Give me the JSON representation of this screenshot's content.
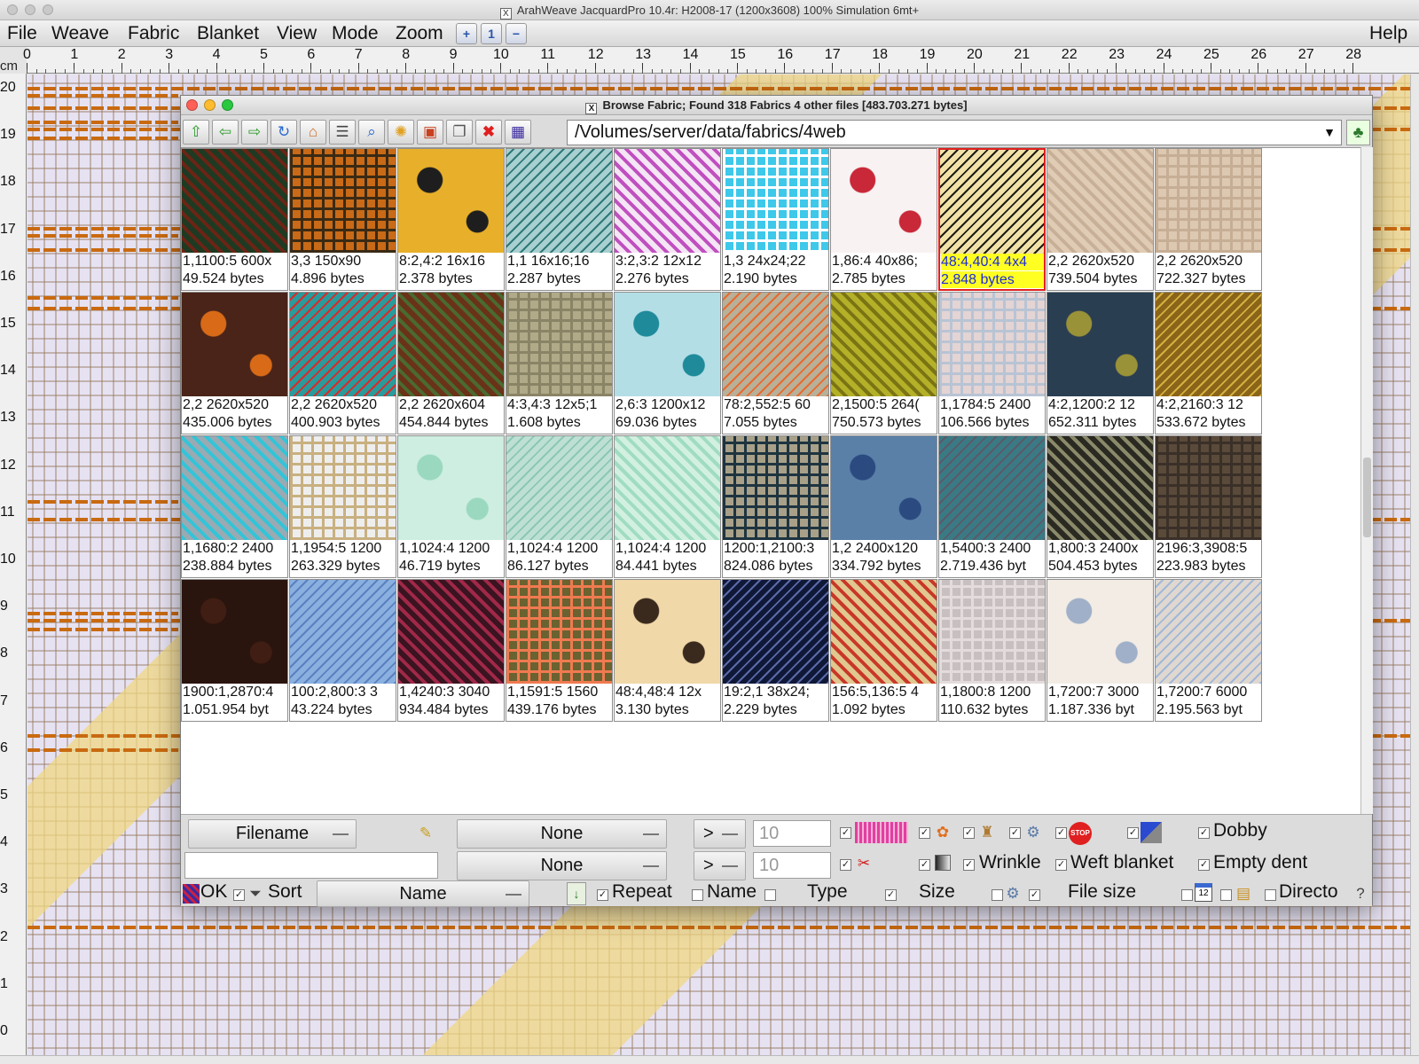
{
  "app": {
    "title": "ArahWeave JacquardPro 10.4r: H2008-17 (1200x3608) 100% Simulation 6mt+"
  },
  "menubar": {
    "items": [
      "File",
      "Weave",
      "Fabric",
      "Blanket",
      "View",
      "Mode",
      "Zoom"
    ],
    "help": "Help"
  },
  "ruler": {
    "unit": "cm",
    "top_ticks": [
      "0",
      "1",
      "2",
      "3",
      "4",
      "5",
      "6",
      "7",
      "8",
      "9",
      "10",
      "11",
      "12",
      "13",
      "14",
      "15",
      "16",
      "17",
      "18",
      "19",
      "20",
      "21",
      "22",
      "23",
      "24",
      "25",
      "26",
      "27",
      "28"
    ],
    "left_ticks": [
      "20",
      "19",
      "18",
      "17",
      "16",
      "15",
      "14",
      "13",
      "12",
      "11",
      "10",
      "9",
      "8",
      "7",
      "6",
      "5",
      "4",
      "3",
      "2",
      "1",
      "0"
    ]
  },
  "dialog": {
    "title": "Browse Fabric; Found 318 Fabrics 4 other files [483.703.271 bytes]",
    "path": "/Volumes/server/data/fabrics/4web",
    "toolbar_icons": [
      "arrow-up-icon",
      "arrow-left-icon",
      "arrow-right-icon",
      "refresh-icon",
      "home-icon",
      "list-view-icon",
      "preview-icon",
      "new-icon",
      "image-icon",
      "copy-icon",
      "delete-icon",
      "fabric-icon"
    ],
    "fabrics": [
      {
        "line1": "1,1100:5 600x",
        "line2": "49.524 bytes",
        "swatch": "#1e3a22",
        "accent": "#6b2415",
        "selected": false
      },
      {
        "line1": "3,3 150x90",
        "line2": "4.896 bytes",
        "swatch": "#c86a18",
        "accent": "#3a2a14",
        "selected": false
      },
      {
        "line1": "8:2,4:2 16x16",
        "line2": "2.378 bytes",
        "swatch": "#e8b02a",
        "accent": "#1e1e1e",
        "selected": false
      },
      {
        "line1": "1,1 16x16;16",
        "line2": "2.287 bytes",
        "swatch": "#a8d0d0",
        "accent": "#2f7878",
        "selected": false
      },
      {
        "line1": "3:2,3:2 12x12",
        "line2": "2.276 bytes",
        "swatch": "#f4e6f4",
        "accent": "#c050c0",
        "selected": false
      },
      {
        "line1": "1,3 24x24;22",
        "line2": "2.190 bytes",
        "swatch": "#3ec8ea",
        "accent": "#ffffff",
        "selected": false
      },
      {
        "line1": "1,86:4 40x86;",
        "line2": "2.785 bytes",
        "swatch": "#f8f2f2",
        "accent": "#c82838",
        "selected": false
      },
      {
        "line1": "48:4,40:4 4x4",
        "line2": "2.848 bytes",
        "swatch": "#f2e2a8",
        "accent": "#1c1c14",
        "selected": true
      },
      {
        "line1": "2,2 2620x520",
        "line2": "739.504 bytes",
        "swatch": "#e0cbb5",
        "accent": "#c8b098",
        "selected": false
      },
      {
        "line1": "2,2 2620x520",
        "line2": "722.327 bytes",
        "swatch": "#ddc8b2",
        "accent": "#c6ae95",
        "selected": false
      },
      {
        "line1": "2,2 2620x520",
        "line2": "435.006 bytes",
        "swatch": "#4a2418",
        "accent": "#d86a18",
        "selected": false
      },
      {
        "line1": "2,2 2620x520",
        "line2": "400.903 bytes",
        "swatch": "#2a9a9a",
        "accent": "#e02828",
        "selected": false
      },
      {
        "line1": "2,2 2620x604",
        "line2": "454.844 bytes",
        "swatch": "#6a3218",
        "accent": "#4a6a30",
        "selected": false
      },
      {
        "line1": "4:3,4:3 12x5;1",
        "line2": "1.608 bytes",
        "swatch": "#b0aa88",
        "accent": "#8a8466",
        "selected": false
      },
      {
        "line1": "2,6:3 1200x12",
        "line2": "69.036 bytes",
        "swatch": "#b4dee6",
        "accent": "#1e8a9a",
        "selected": false
      },
      {
        "line1": "78:2,552:5 60",
        "line2": "7.055 bytes",
        "swatch": "#b8b098",
        "accent": "#e86a30",
        "selected": false
      },
      {
        "line1": "2,1500:5 264(",
        "line2": "750.573 bytes",
        "swatch": "#b4b028",
        "accent": "#7a7414",
        "selected": false
      },
      {
        "line1": "1,1784:5 2400",
        "line2": "106.566 bytes",
        "swatch": "#e4d4d4",
        "accent": "#b8c4d4",
        "selected": false
      },
      {
        "line1": "4:2,1200:2 12",
        "line2": "652.311 bytes",
        "swatch": "#2a3e52",
        "accent": "#9a9238",
        "selected": false
      },
      {
        "line1": "4:2,2160:3 12",
        "line2": "533.672 bytes",
        "swatch": "#8a6418",
        "accent": "#d4b040",
        "selected": false
      },
      {
        "line1": "1,1680:2 2400",
        "line2": "238.884 bytes",
        "swatch": "#9aaab2",
        "accent": "#34c4d8",
        "selected": false
      },
      {
        "line1": "1,1954:5 1200",
        "line2": "263.329 bytes",
        "swatch": "#eeeeee",
        "accent": "#c8b080",
        "selected": false
      },
      {
        "line1": "1,1024:4 1200",
        "line2": "46.719 bytes",
        "swatch": "#cdeee0",
        "accent": "#9ad8c0",
        "selected": false
      },
      {
        "line1": "1,1024:4 1200",
        "line2": "86.127 bytes",
        "swatch": "#bee0d4",
        "accent": "#8cc8b4",
        "selected": false
      },
      {
        "line1": "1,1024:4 1200",
        "line2": "84.441 bytes",
        "swatch": "#d2f0e0",
        "accent": "#a0dcc2",
        "selected": false
      },
      {
        "line1": "1200:1,2100:3",
        "line2": "824.086 bytes",
        "swatch": "#a8a088",
        "accent": "#1e3440",
        "selected": false
      },
      {
        "line1": "1,2 2400x120",
        "line2": "334.792 bytes",
        "swatch": "#5a80a8",
        "accent": "#2a4a80",
        "selected": false
      },
      {
        "line1": "1,5400:3 2400",
        "line2": "2.719.436 byt",
        "swatch": "#3a7a84",
        "accent": "#5a5a6a",
        "selected": false
      },
      {
        "line1": "1,800:3 2400x",
        "line2": "504.453 bytes",
        "swatch": "#2a2a22",
        "accent": "#8a8a6a",
        "selected": false
      },
      {
        "line1": "2196:3,3908:5",
        "line2": "223.983 bytes",
        "swatch": "#5a4a3a",
        "accent": "#3a3028",
        "selected": false
      },
      {
        "line1": "1900:1,2870:4",
        "line2": "1.051.954 byt",
        "swatch": "#2a140e",
        "accent": "#401e14",
        "selected": false
      },
      {
        "line1": "100:2,800:3 3",
        "line2": "43.224 bytes",
        "swatch": "#8ab0e0",
        "accent": "#5a80c0",
        "selected": false
      },
      {
        "line1": "1,4240:3 3040",
        "line2": "934.484 bytes",
        "swatch": "#3a1420",
        "accent": "#a02848",
        "selected": false
      },
      {
        "line1": "1,1591:5 1560",
        "line2": "439.176 bytes",
        "swatch": "#6a6230",
        "accent": "#f07a50",
        "selected": false
      },
      {
        "line1": "48:4,48:4 12x",
        "line2": "3.130 bytes",
        "swatch": "#f0d8a8",
        "accent": "#3a2a1e",
        "selected": false
      },
      {
        "line1": "19:2,1 38x24;",
        "line2": "2.229 bytes",
        "swatch": "#101838",
        "accent": "#5a6aa8",
        "selected": false
      },
      {
        "line1": "156:5,136:5 4",
        "line2": "1.092 bytes",
        "swatch": "#e0c890",
        "accent": "#c83828",
        "selected": false
      },
      {
        "line1": "1,1800:8 1200",
        "line2": "110.632 bytes",
        "swatch": "#c8c0c0",
        "accent": "#e4dcdc",
        "selected": false
      },
      {
        "line1": "1,7200:7 3000",
        "line2": "1.187.336 byt",
        "swatch": "#f2ece4",
        "accent": "#a0b0c8",
        "selected": false
      },
      {
        "line1": "1,7200:7 6000",
        "line2": "2.195.563 byt",
        "swatch": "#e0d8d0",
        "accent": "#a0b8d8",
        "selected": false
      }
    ],
    "filter": {
      "field1": "Filename",
      "field2_value": "",
      "combo1": "None",
      "combo2": "None",
      "op1": ">",
      "op2": ">",
      "num1": "10",
      "num2": "10",
      "wrinkle": "Wrinkle",
      "weft_blanket": "Weft blanket",
      "dobby": "Dobby",
      "empty_dent": "Empty dent"
    },
    "sortbar": {
      "ok": "OK",
      "sort": "Sort",
      "sort_by": "Name",
      "repeat": "Repeat",
      "name": "Name",
      "type": "Type",
      "size": "Size",
      "file_size": "File size",
      "directory": "Directo"
    }
  }
}
